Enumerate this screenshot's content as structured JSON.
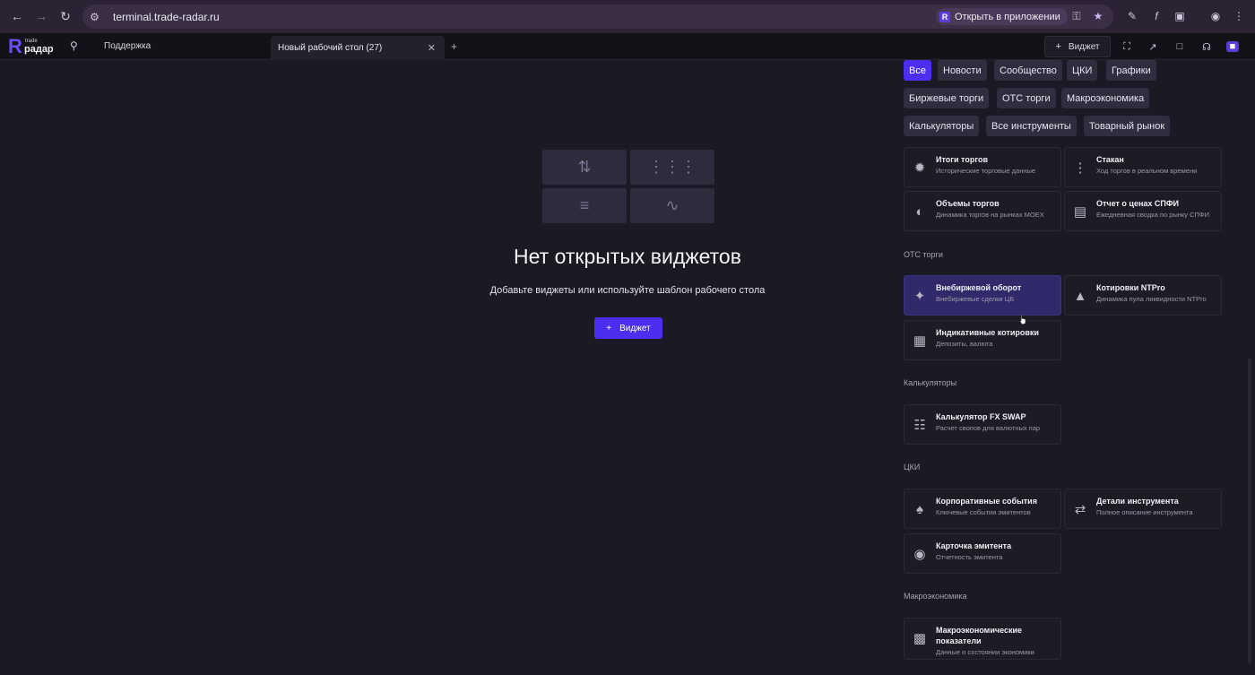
{
  "browser": {
    "url": "terminal.trade-radar.ru",
    "open_app": "Открыть в приложении"
  },
  "header": {
    "logo_small": "trade",
    "logo_main": "радар",
    "support": "Поддержка",
    "tab_label": "Новый рабочий стол (27)",
    "widget_button": "Виджет"
  },
  "empty": {
    "title": "Нет открытых виджетов",
    "subtitle": "Добавьте виджеты или используйте шаблон рабочего стола",
    "button": "Виджет"
  },
  "filters": [
    "Все",
    "Новости",
    "Сообщество",
    "ЦКИ",
    "Графики",
    "Биржевые торги",
    "ОТС торги",
    "Макроэкономика",
    "Калькуляторы",
    "Все инструменты",
    "Товарный рынок"
  ],
  "sections": {
    "otc": "ОТС торги",
    "calc": "Калькуляторы",
    "cki": "ЦКИ",
    "macro": "Макроэкономика"
  },
  "cards": {
    "c1": {
      "title": "Итоги торгов",
      "desc": "Исторические торговые данные"
    },
    "c2": {
      "title": "Стакан",
      "desc": "Ход торгов в реальном времени"
    },
    "c3": {
      "title": "Объемы торгов",
      "desc": "Динамика торгов на рынках MOEX"
    },
    "c4": {
      "title": "Отчет о ценах СПФИ",
      "desc": "Ежедневная сводка по рынку СПФИ"
    },
    "c5": {
      "title": "Внебиржевой оборот",
      "desc": "Внебиржевые сделки ЦБ"
    },
    "c6": {
      "title": "Котировки NTPro",
      "desc": "Динамика пула ликвидности NTPro"
    },
    "c7": {
      "title": "Индикативные котировки",
      "desc": "Депозиты, валюта"
    },
    "c8": {
      "title": "Калькулятор FX SWAP",
      "desc": "Расчет свопов для валютных пар"
    },
    "c9": {
      "title": "Корпоративные события",
      "desc": "Ключевые события эмитентов"
    },
    "c10": {
      "title": "Детали инструмента",
      "desc": "Полное описание инструмента"
    },
    "c11": {
      "title": "Карточка эмитента",
      "desc": "Отчетность эмитента"
    },
    "c12": {
      "title": "Макроэкономические показатели",
      "desc": "Данные о состоянии экономики"
    }
  },
  "colors": {
    "accent": "#4b2ef0",
    "background": "#1b1924",
    "selected_card": "#312a6a"
  }
}
